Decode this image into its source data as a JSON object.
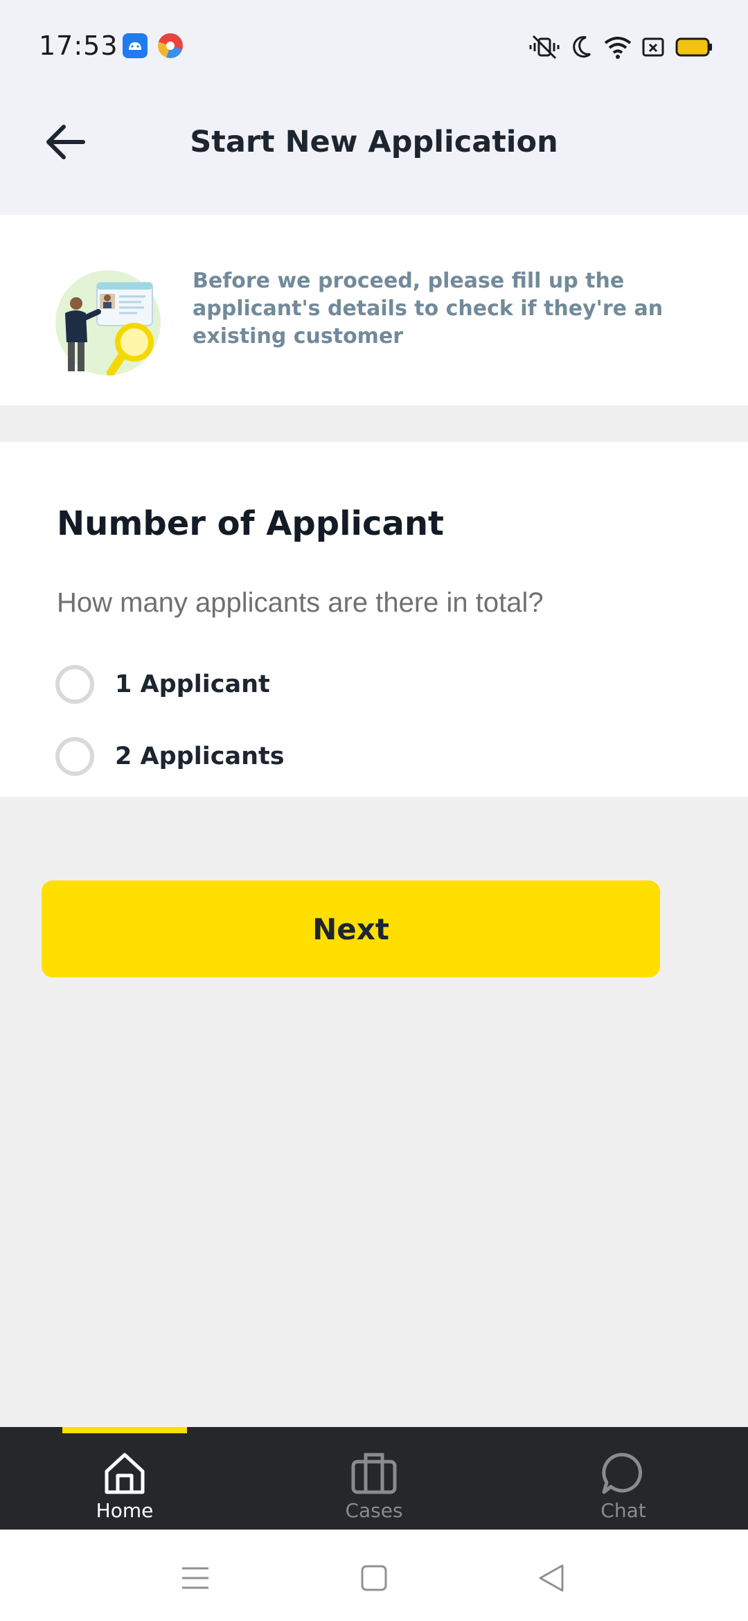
{
  "status_bar": {
    "time": "17:53",
    "icons": [
      "android-app-icon",
      "browser-app-icon",
      "vibrate-icon",
      "moon-icon",
      "wifi-icon",
      "sim-icon",
      "battery-icon"
    ]
  },
  "header": {
    "title": "Start New Application",
    "back_icon": "arrow-left-icon"
  },
  "info_banner": {
    "text": "Before we proceed, please fill up the applicant's details to check if they're an existing customer"
  },
  "form": {
    "section_title": "Number of Applicant",
    "question": "How many applicants are there in total?",
    "options": [
      {
        "label": "1 Applicant",
        "selected": false
      },
      {
        "label": "2 Applicants",
        "selected": false
      }
    ]
  },
  "next_button": {
    "label": "Next"
  },
  "bottom_nav": {
    "items": [
      {
        "label": "Home",
        "icon": "home-icon",
        "active": true
      },
      {
        "label": "Cases",
        "icon": "briefcase-icon",
        "active": false
      },
      {
        "label": "Chat",
        "icon": "chat-bubble-icon",
        "active": false
      }
    ]
  },
  "colors": {
    "accent": "#ffdf00",
    "header_bg": "#f1f2f7",
    "nav_bg": "#26272b",
    "info_text": "#728a99"
  }
}
